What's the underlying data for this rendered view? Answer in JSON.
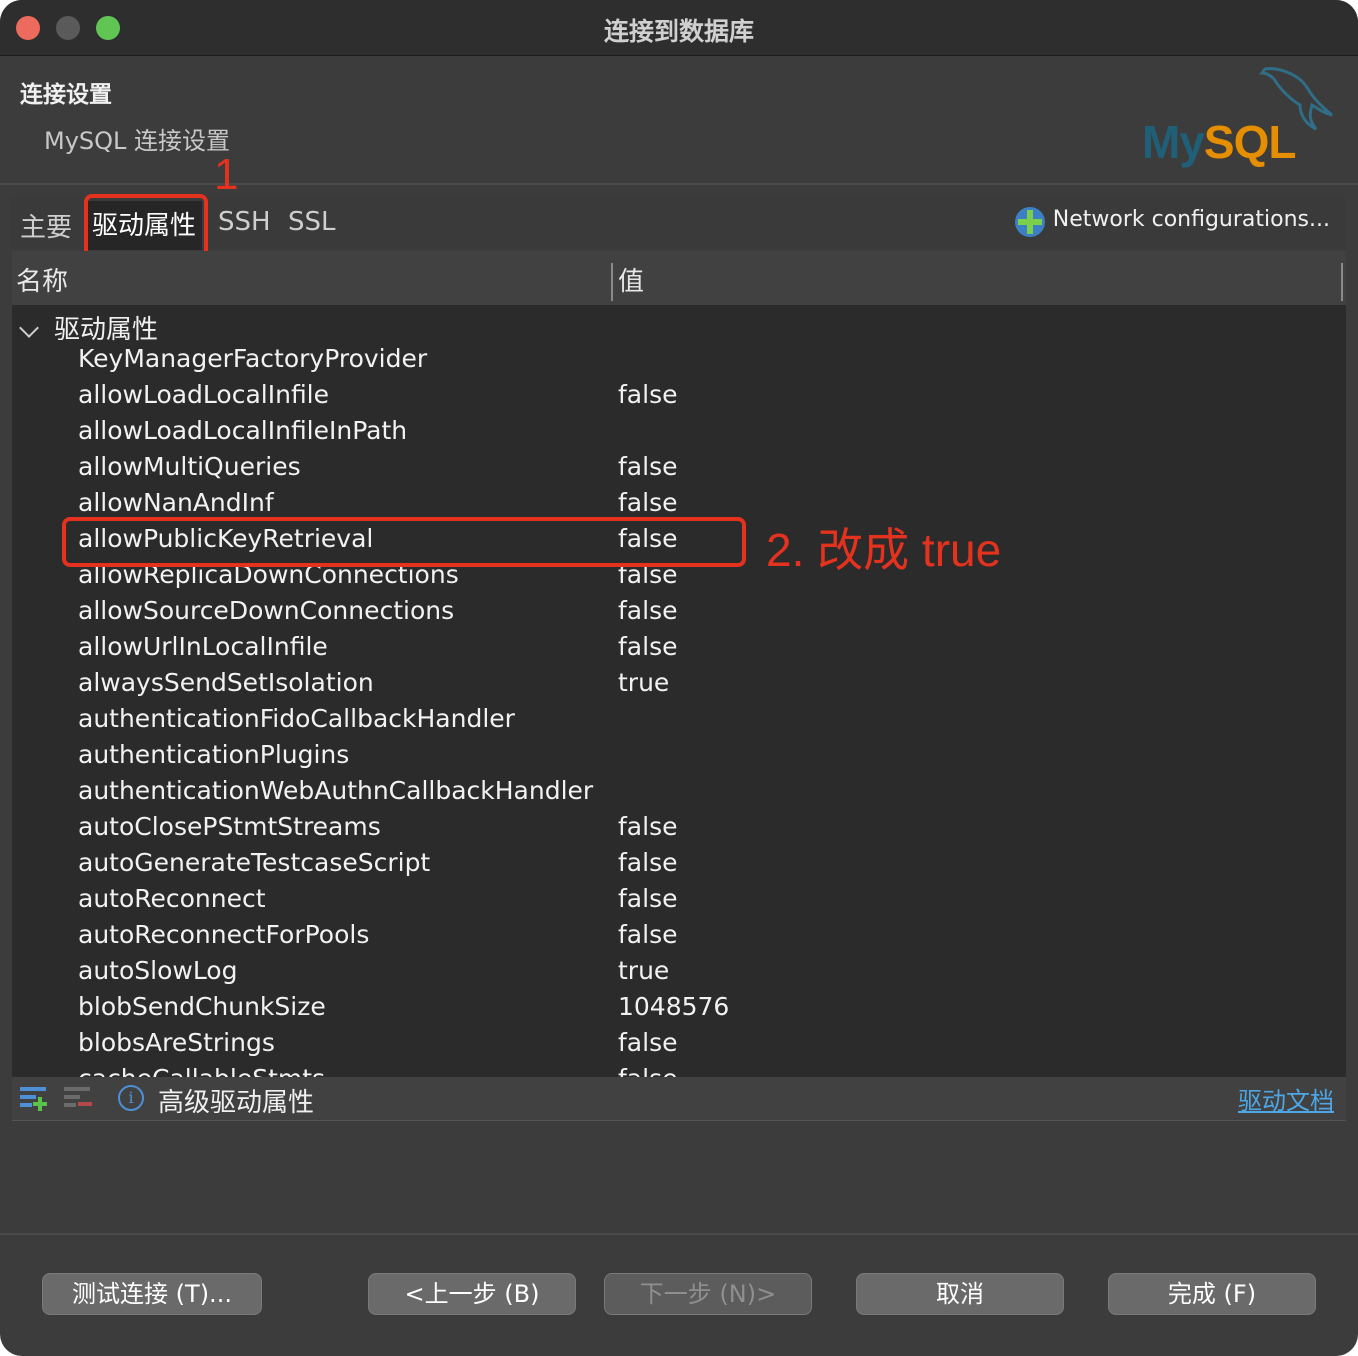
{
  "window": {
    "title": "连接到数据库"
  },
  "header": {
    "title": "连接设置",
    "subtitle": "MySQL 连接设置",
    "logo": {
      "my": "My",
      "sql": "SQL"
    }
  },
  "tabs": [
    {
      "label": "主要",
      "active": false
    },
    {
      "label": "驱动属性",
      "active": true
    },
    {
      "label": "SSH",
      "active": false
    },
    {
      "label": "SSL",
      "active": false
    }
  ],
  "network_config": {
    "label": "Network configurations...",
    "icon": "plus-icon"
  },
  "table": {
    "columns": [
      "名称",
      "值"
    ],
    "group": "驱动属性",
    "rows": [
      {
        "name": "KeyManagerFactoryProvider",
        "value": ""
      },
      {
        "name": "allowLoadLocalInfile",
        "value": "false"
      },
      {
        "name": "allowLoadLocalInfileInPath",
        "value": ""
      },
      {
        "name": "allowMultiQueries",
        "value": "false"
      },
      {
        "name": "allowNanAndInf",
        "value": "false"
      },
      {
        "name": "allowPublicKeyRetrieval",
        "value": "false"
      },
      {
        "name": "allowReplicaDownConnections",
        "value": "false"
      },
      {
        "name": "allowSourceDownConnections",
        "value": "false"
      },
      {
        "name": "allowUrlInLocalInfile",
        "value": "false"
      },
      {
        "name": "alwaysSendSetIsolation",
        "value": "true"
      },
      {
        "name": "authenticationFidoCallbackHandler",
        "value": ""
      },
      {
        "name": "authenticationPlugins",
        "value": ""
      },
      {
        "name": "authenticationWebAuthnCallbackHandler",
        "value": ""
      },
      {
        "name": "autoClosePStmtStreams",
        "value": "false"
      },
      {
        "name": "autoGenerateTestcaseScript",
        "value": "false"
      },
      {
        "name": "autoReconnect",
        "value": "false"
      },
      {
        "name": "autoReconnectForPools",
        "value": "false"
      },
      {
        "name": "autoSlowLog",
        "value": "true"
      },
      {
        "name": "blobSendChunkSize",
        "value": "1048576"
      },
      {
        "name": "blobsAreStrings",
        "value": "false"
      },
      {
        "name": "cacheCallableStmts",
        "value": "false"
      }
    ]
  },
  "footer": {
    "advanced_label": "高级驱动属性",
    "doc_link": "驱动文档"
  },
  "annotations": {
    "step1": "1",
    "step2": "2. 改成 true",
    "color": "#e5321f"
  },
  "buttons": {
    "test": "测试连接 (T)...",
    "prev": "<上一步 (B)",
    "next": "下一步 (N)>",
    "cancel": "取消",
    "finish": "完成 (F)"
  }
}
